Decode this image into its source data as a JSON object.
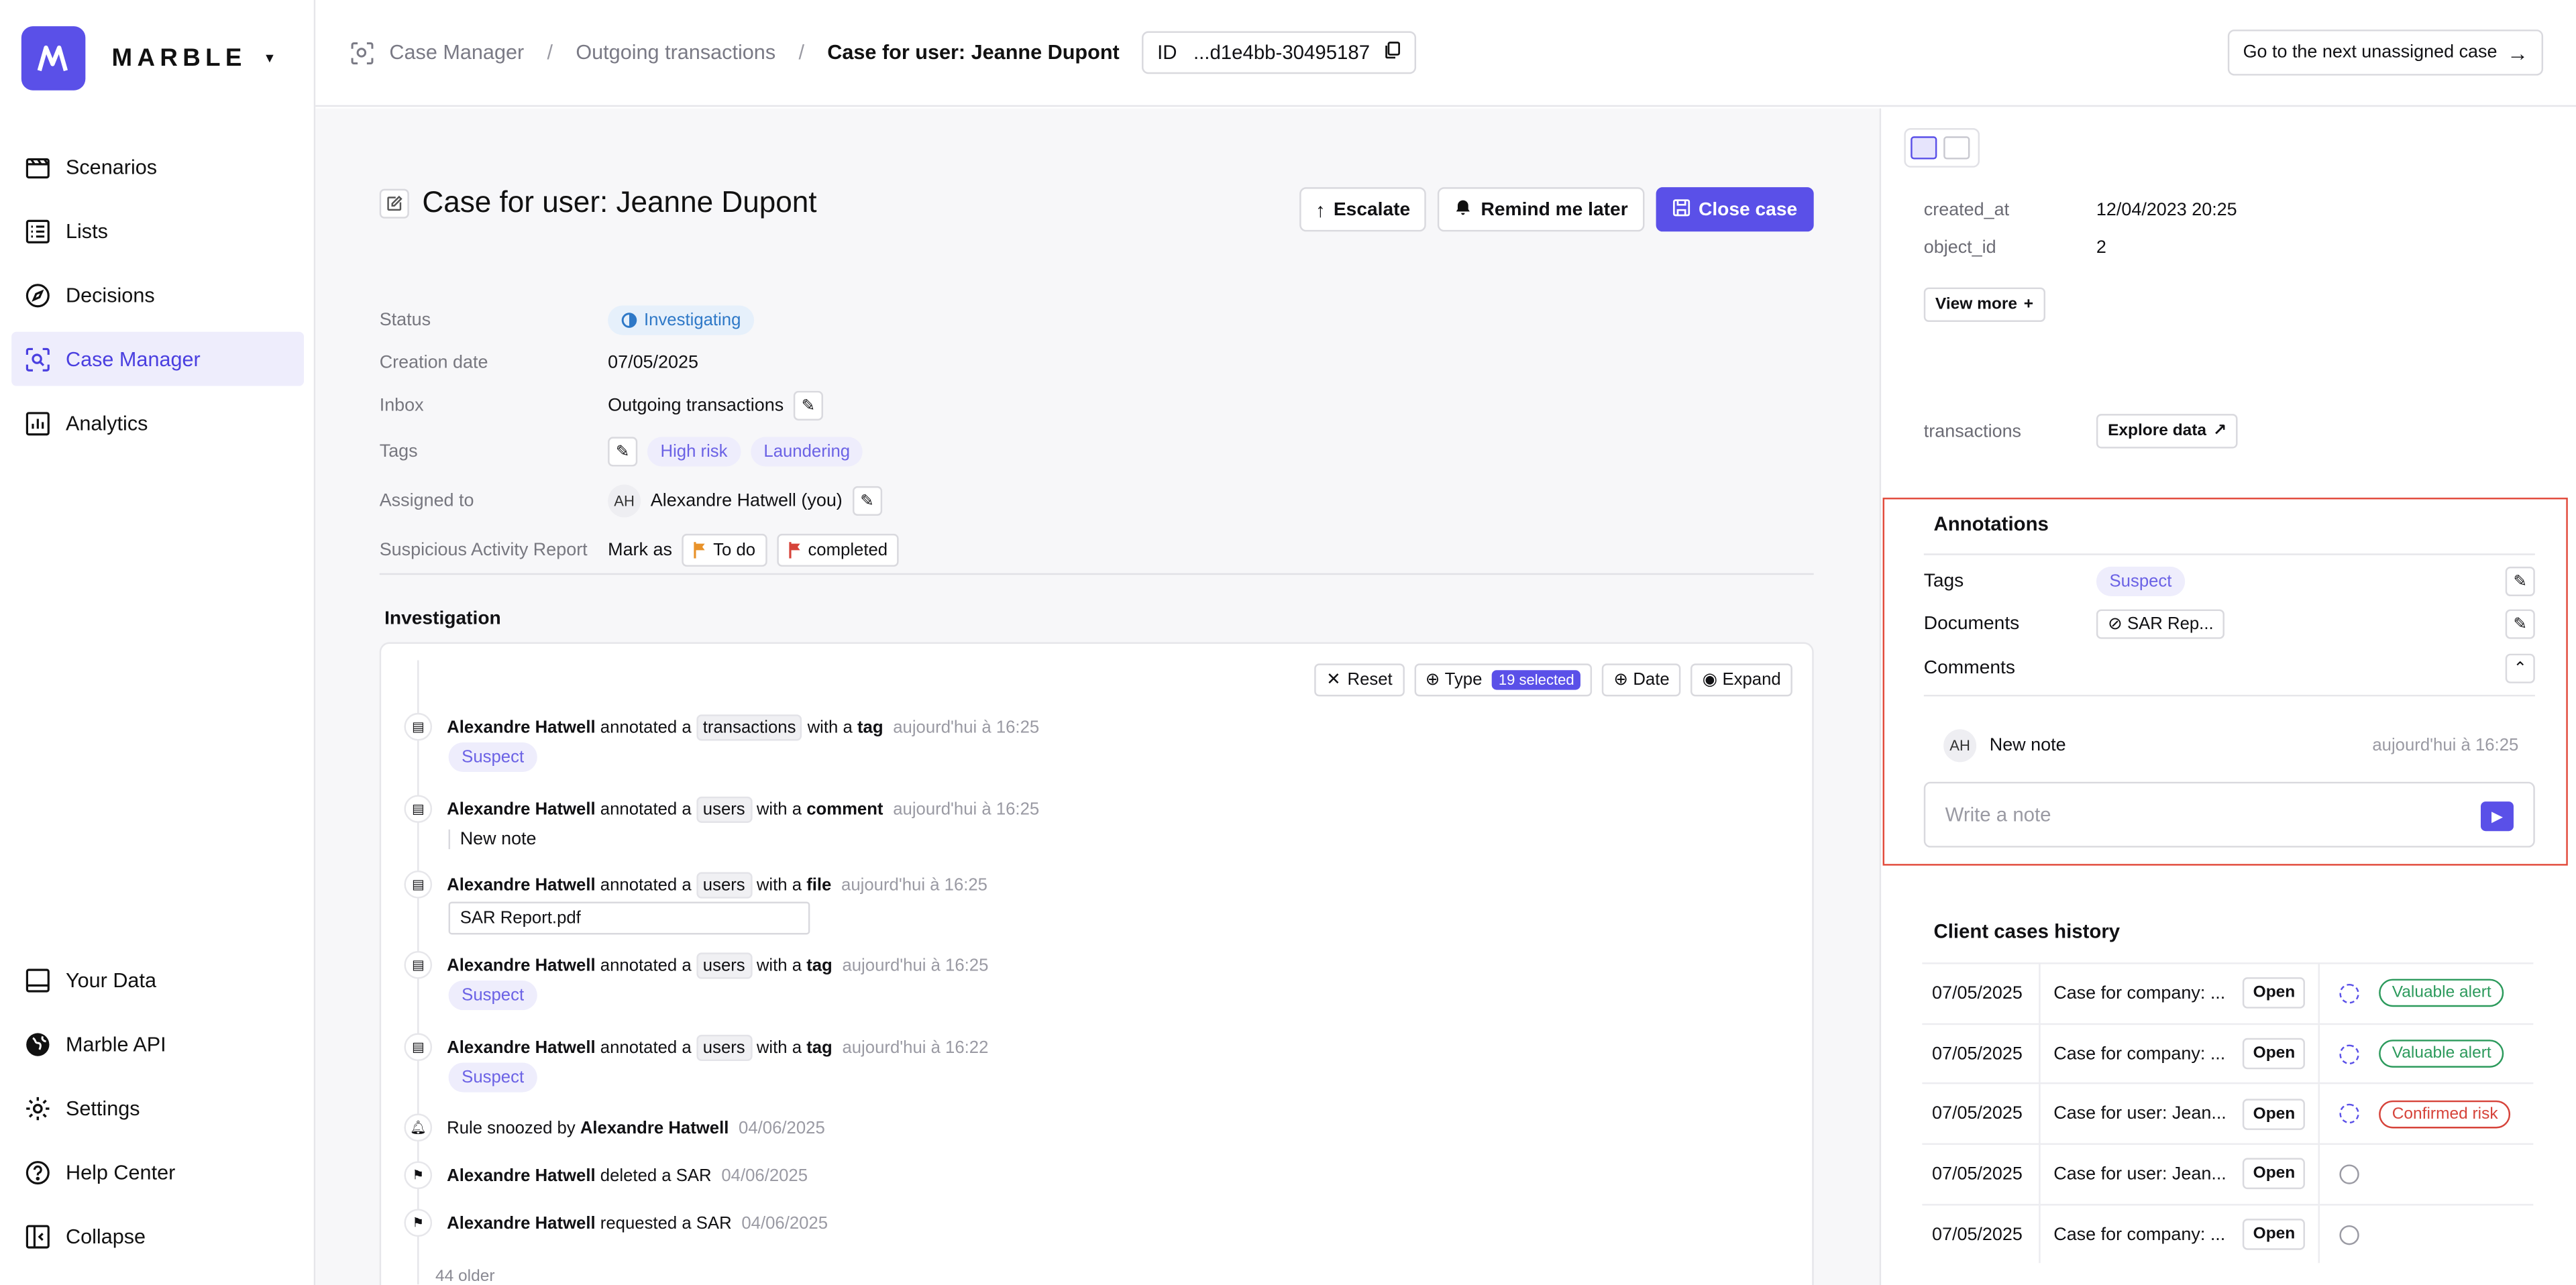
{
  "app": {
    "brand": "MARBLE",
    "accent": "#5a50e8"
  },
  "sidebar": {
    "items": [
      {
        "label": "Scenarios",
        "icon": "clapperboard-icon"
      },
      {
        "label": "Lists",
        "icon": "list-icon"
      },
      {
        "label": "Decisions",
        "icon": "compass-icon"
      },
      {
        "label": "Case Manager",
        "icon": "scan-search-icon",
        "active": true
      },
      {
        "label": "Analytics",
        "icon": "bar-chart-icon"
      }
    ],
    "bottom_items": [
      {
        "label": "Your Data",
        "icon": "database-icon"
      },
      {
        "label": "Marble API",
        "icon": "globe-icon"
      },
      {
        "label": "Settings",
        "icon": "gear-icon"
      },
      {
        "label": "Help Center",
        "icon": "help-circle-icon"
      },
      {
        "label": "Collapse",
        "icon": "panel-collapse-icon"
      }
    ]
  },
  "header": {
    "breadcrumb": [
      "Case Manager",
      "Outgoing transactions",
      "Case for user: Jeanne Dupont"
    ],
    "id_label": "ID",
    "id_value": "...d1e4bb-30495187",
    "next_button": "Go to the next unassigned case"
  },
  "case": {
    "title": "Case for user: Jeanne Dupont",
    "actions": {
      "escalate": "Escalate",
      "remind": "Remind me later",
      "close": "Close case"
    },
    "fields": {
      "status_label": "Status",
      "status_value": "Investigating",
      "creation_label": "Creation date",
      "creation_value": "07/05/2025",
      "inbox_label": "Inbox",
      "inbox_value": "Outgoing transactions",
      "tags_label": "Tags",
      "tags": [
        "High risk",
        "Laundering"
      ],
      "assigned_label": "Assigned to",
      "assigned_initials": "AH",
      "assigned_value": "Alexandre Hatwell (you)",
      "sar_label": "Suspicious Activity Report",
      "sar_mark": "Mark as",
      "sar_todo": "To do",
      "sar_completed": "completed"
    }
  },
  "investigation": {
    "title": "Investigation",
    "toolbar": {
      "reset": "Reset",
      "type": "Type",
      "selected": "19 selected",
      "date": "Date",
      "expand": "Expand"
    },
    "events": [
      {
        "user": "Alexandre Hatwell",
        "action": "annotated a",
        "object": "transactions",
        "with": "with a",
        "kind": "tag",
        "time": "aujourd'hui à 16:25",
        "sub": "Suspect"
      },
      {
        "user": "Alexandre Hatwell",
        "action": "annotated a",
        "object": "users",
        "with": "with a",
        "kind": "comment",
        "time": "aujourd'hui à 16:25",
        "sub": "New note"
      },
      {
        "user": "Alexandre Hatwell",
        "action": "annotated a",
        "object": "users",
        "with": "with a",
        "kind": "file",
        "time": "aujourd'hui à 16:25",
        "sub": "SAR Report.pdf"
      },
      {
        "user": "Alexandre Hatwell",
        "action": "annotated a",
        "object": "users",
        "with": "with a",
        "kind": "tag",
        "time": "aujourd'hui à 16:25",
        "sub": "Suspect"
      },
      {
        "user": "Alexandre Hatwell",
        "action": "annotated a",
        "object": "users",
        "with": "with a",
        "kind": "tag",
        "time": "aujourd'hui à 16:22",
        "sub": "Suspect"
      }
    ],
    "simple_events": [
      {
        "pre": "Rule snoozed by",
        "user": "Alexandre Hatwell",
        "post": "",
        "time": "04/06/2025"
      },
      {
        "pre": "",
        "user": "Alexandre Hatwell",
        "post": "deleted a SAR",
        "time": "04/06/2025"
      },
      {
        "pre": "",
        "user": "Alexandre Hatwell",
        "post": "requested a SAR",
        "time": "04/06/2025"
      }
    ],
    "older": "44 older"
  },
  "right_panel": {
    "created_at_label": "created_at",
    "created_at_value": "12/04/2023 20:25",
    "object_id_label": "object_id",
    "object_id_value": "2",
    "view_more": "View more",
    "transactions_label": "transactions",
    "explore": "Explore data",
    "annotations": {
      "title": "Annotations",
      "tags_label": "Tags",
      "tag": "Suspect",
      "documents_label": "Documents",
      "document": "SAR Rep...",
      "comments_label": "Comments",
      "note_initials": "AH",
      "note_text": "New note",
      "note_time": "aujourd'hui à 16:25",
      "placeholder": "Write a note"
    },
    "history": {
      "title": "Client cases history",
      "open_label": "Open",
      "rows": [
        {
          "date": "07/05/2025",
          "name": "Case for company: ...",
          "done": true,
          "badge": "Valuable alert",
          "badge_color": "green"
        },
        {
          "date": "07/05/2025",
          "name": "Case for company: ...",
          "done": true,
          "badge": "Valuable alert",
          "badge_color": "green"
        },
        {
          "date": "07/05/2025",
          "name": "Case for user: Jean...",
          "done": true,
          "badge": "Confirmed risk",
          "badge_color": "red"
        },
        {
          "date": "07/05/2025",
          "name": "Case for user: Jean...",
          "done": false,
          "badge": "",
          "badge_color": ""
        },
        {
          "date": "07/05/2025",
          "name": "Case for company: ...",
          "done": false,
          "badge": "",
          "badge_color": ""
        }
      ]
    }
  }
}
